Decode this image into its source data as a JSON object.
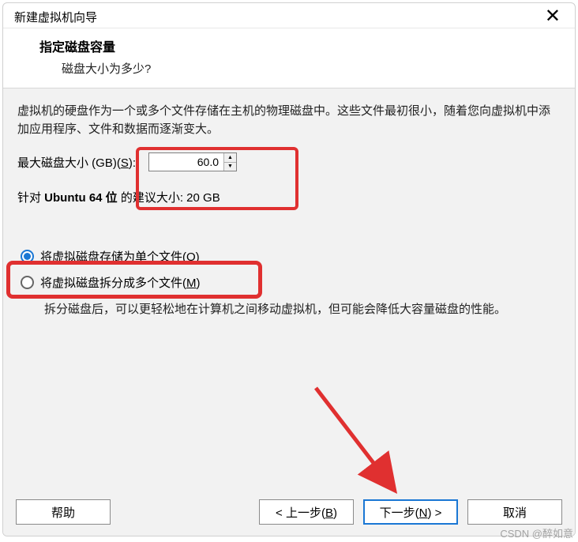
{
  "titlebar": {
    "title": "新建虚拟机向导",
    "close": "✕"
  },
  "header": {
    "title": "指定磁盘容量",
    "subtitle": "磁盘大小为多少?"
  },
  "content": {
    "description": "虚拟机的硬盘作为一个或多个文件存储在主机的物理磁盘中。这些文件最初很小，随着您向虚拟机中添加应用程序、文件和数据而逐渐变大。",
    "size_label_prefix": "最大磁盘大小 (GB)(",
    "size_hotkey": "S",
    "size_label_suffix": "):",
    "size_value": "60.0",
    "recommend_prefix": "针对 ",
    "recommend_os": "Ubuntu 64 位",
    "recommend_suffix": " 的建议大小: 20 GB",
    "radio_single_prefix": "将虚拟磁盘存储为单个文件(",
    "radio_single_hotkey": "O",
    "radio_single_suffix": ")",
    "radio_split_prefix": "将虚拟磁盘拆分成多个文件(",
    "radio_split_hotkey": "M",
    "radio_split_suffix": ")",
    "radio_note": "拆分磁盘后，可以更轻松地在计算机之间移动虚拟机，但可能会降低大容量磁盘的性能。"
  },
  "footer": {
    "help": "帮助",
    "back_prefix": "< 上一步(",
    "back_hotkey": "B",
    "back_suffix": ")",
    "next_prefix": "下一步(",
    "next_hotkey": "N",
    "next_suffix": ") >",
    "cancel": "取消"
  },
  "watermark": "CSDN @醉如意"
}
